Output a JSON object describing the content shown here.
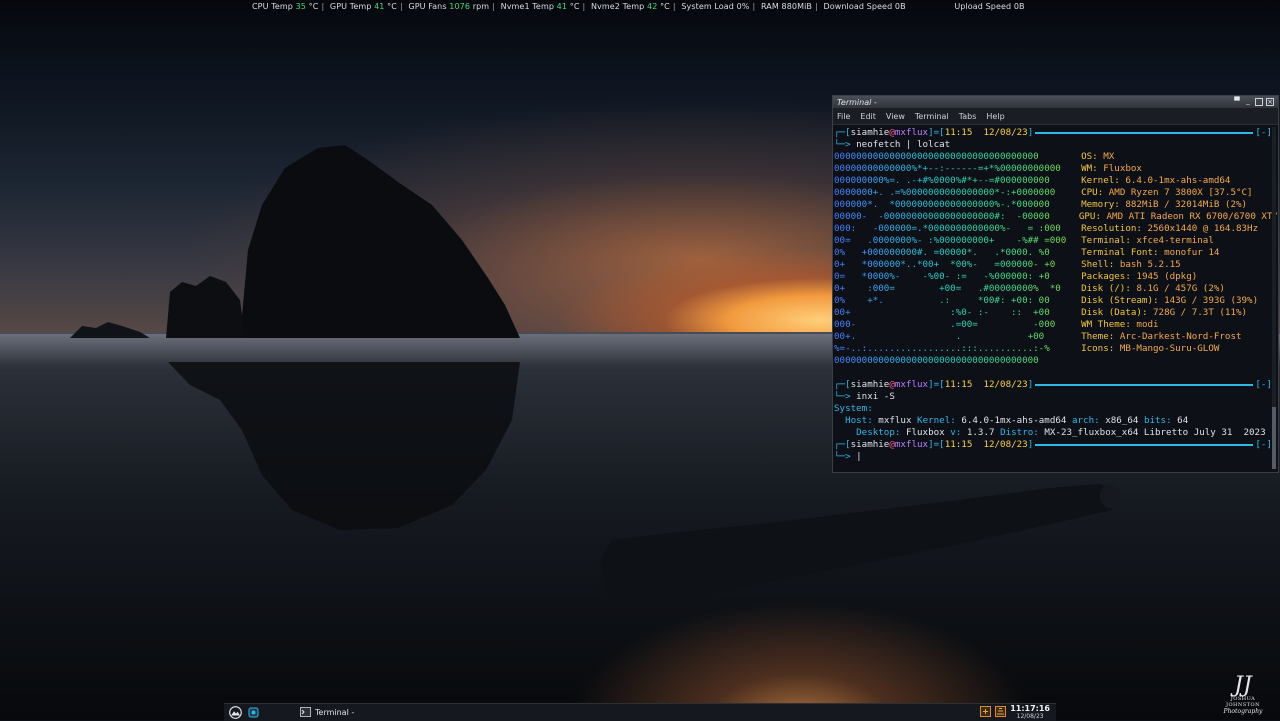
{
  "conky": {
    "cpu_label": "CPU Temp",
    "cpu_val": "35",
    "cpu_unit": "°C",
    "gpu_label": "GPU Temp",
    "gpu_val": "41",
    "gpu_unit": "°C",
    "fans_label": "GPU Fans",
    "fans_val": "1076",
    "fans_unit": "rpm",
    "nvme1_label": "Nvme1 Temp",
    "nvme1_val": "41",
    "nvme1_unit": "°C",
    "nvme2_label": "Nvme2 Temp",
    "nvme2_val": "42",
    "nvme2_unit": "°C",
    "load": "System Load 0%",
    "ram": "RAM 880MiB",
    "down": "Download Speed 0B",
    "up": "Upload Speed 0B"
  },
  "terminal": {
    "title": "Terminal -",
    "menu": [
      "File",
      "Edit",
      "View",
      "Terminal",
      "Tabs",
      "Help"
    ],
    "prompt": {
      "user": "siamhie",
      "at": "@",
      "host": "mxflux",
      "time": "11:15",
      "date": "12/08/23",
      "tag": "[-]"
    },
    "cmd1": "neofetch | lolcat",
    "neofetch_art": [
      "0000000000000000000000000000000000000",
      "00000000000000%*+--:------=+*%00000000000",
      "000000000%=. .-+#%0000%#*+--=#000000000",
      "0000000+. .=%0000000000000000*-:+0000000",
      "000000*.  *000000000000000000%-.*000000",
      "00000-  -00000000000000000000#:  -00000",
      "000:   -000000=.*0000000000000%-   = :000",
      "00=   .0000000%- :%000000000+    -%## =000",
      "0%   +000000000#. =00000*.   .*0000. %0",
      "0+   *000000*..*00+  *00%-   =000000- +0",
      "0=   *0000%-    -%00- :=   -%000000: +0",
      "0+    :000=        +00=   .#00000000%  *0",
      "0%    +*.          .:     *00#: +00: 00",
      "00+                  :%0- :-    ::  +00",
      "000-                 .=00=          -000",
      "00+.                  .            +00",
      "%=-..:.................:::..........:-%",
      "0000000000000000000000000000000000000"
    ],
    "neofetch_info": [
      {
        "k": "OS",
        "v": "MX"
      },
      {
        "k": "WM",
        "v": "Fluxbox"
      },
      {
        "k": "Kernel",
        "v": "6.4.0-1mx-ahs-amd64"
      },
      {
        "k": "CPU",
        "v": "AMD Ryzen 7 3800X [37.5°C]"
      },
      {
        "k": "Memory",
        "v": "882MiB / 32014MiB (2%)"
      },
      {
        "k": "GPU",
        "v": "AMD ATI Radeon RX 6700/6700 XT/"
      },
      {
        "k": "Resolution",
        "v": "2560x1440 @ 164.83Hz"
      },
      {
        "k": "Terminal",
        "v": "xfce4-terminal"
      },
      {
        "k": "Terminal Font",
        "v": "monofur 14"
      },
      {
        "k": "Shell",
        "v": "bash 5.2.15"
      },
      {
        "k": "Packages",
        "v": "1945 (dpkg)"
      },
      {
        "k": "Disk (/)",
        "v": "8.1G / 457G (2%)"
      },
      {
        "k": "Disk (Stream)",
        "v": "143G / 393G (39%)"
      },
      {
        "k": "Disk (Data)",
        "v": "728G / 7.3T (11%)"
      },
      {
        "k": "WM Theme",
        "v": "modi"
      },
      {
        "k": "Theme",
        "v": "Arc-Darkest-Nord-Frost"
      },
      {
        "k": "Icons",
        "v": "MB-Mango-Suru-GLOW"
      },
      {
        "k": "",
        "v": ""
      }
    ],
    "cmd2": "inxi -S",
    "inxi": {
      "system": "System:",
      "host_k": "Host:",
      "host_v": "mxflux",
      "kernel_k": "Kernel:",
      "kernel_v": "6.4.0-1mx-ahs-amd64",
      "arch_k": "arch:",
      "arch_v": "x86_64",
      "bits_k": "bits:",
      "bits_v": "64",
      "desktop_k": "Desktop:",
      "desktop_v": "Fluxbox",
      "ver_k": "v:",
      "ver_v": "1.3.7",
      "distro_k": "Distro:",
      "distro_v": "MX-23_fluxbox_x64 Libretto July 31  2023"
    },
    "cursor": "|"
  },
  "taskbar": {
    "task_label": "Terminal -",
    "time": "11:17:16",
    "date": "12/08/23"
  },
  "watermark": {
    "mono": "JJ",
    "line1": "JOSHUA",
    "line2": "JOHNSTON",
    "line3": "Photography"
  },
  "colors": {
    "accent": "#2fb8e6",
    "conky_value": "#3ddc84",
    "neofetch_key": "#f1c63a",
    "neofetch_val": "#f3a94b"
  }
}
